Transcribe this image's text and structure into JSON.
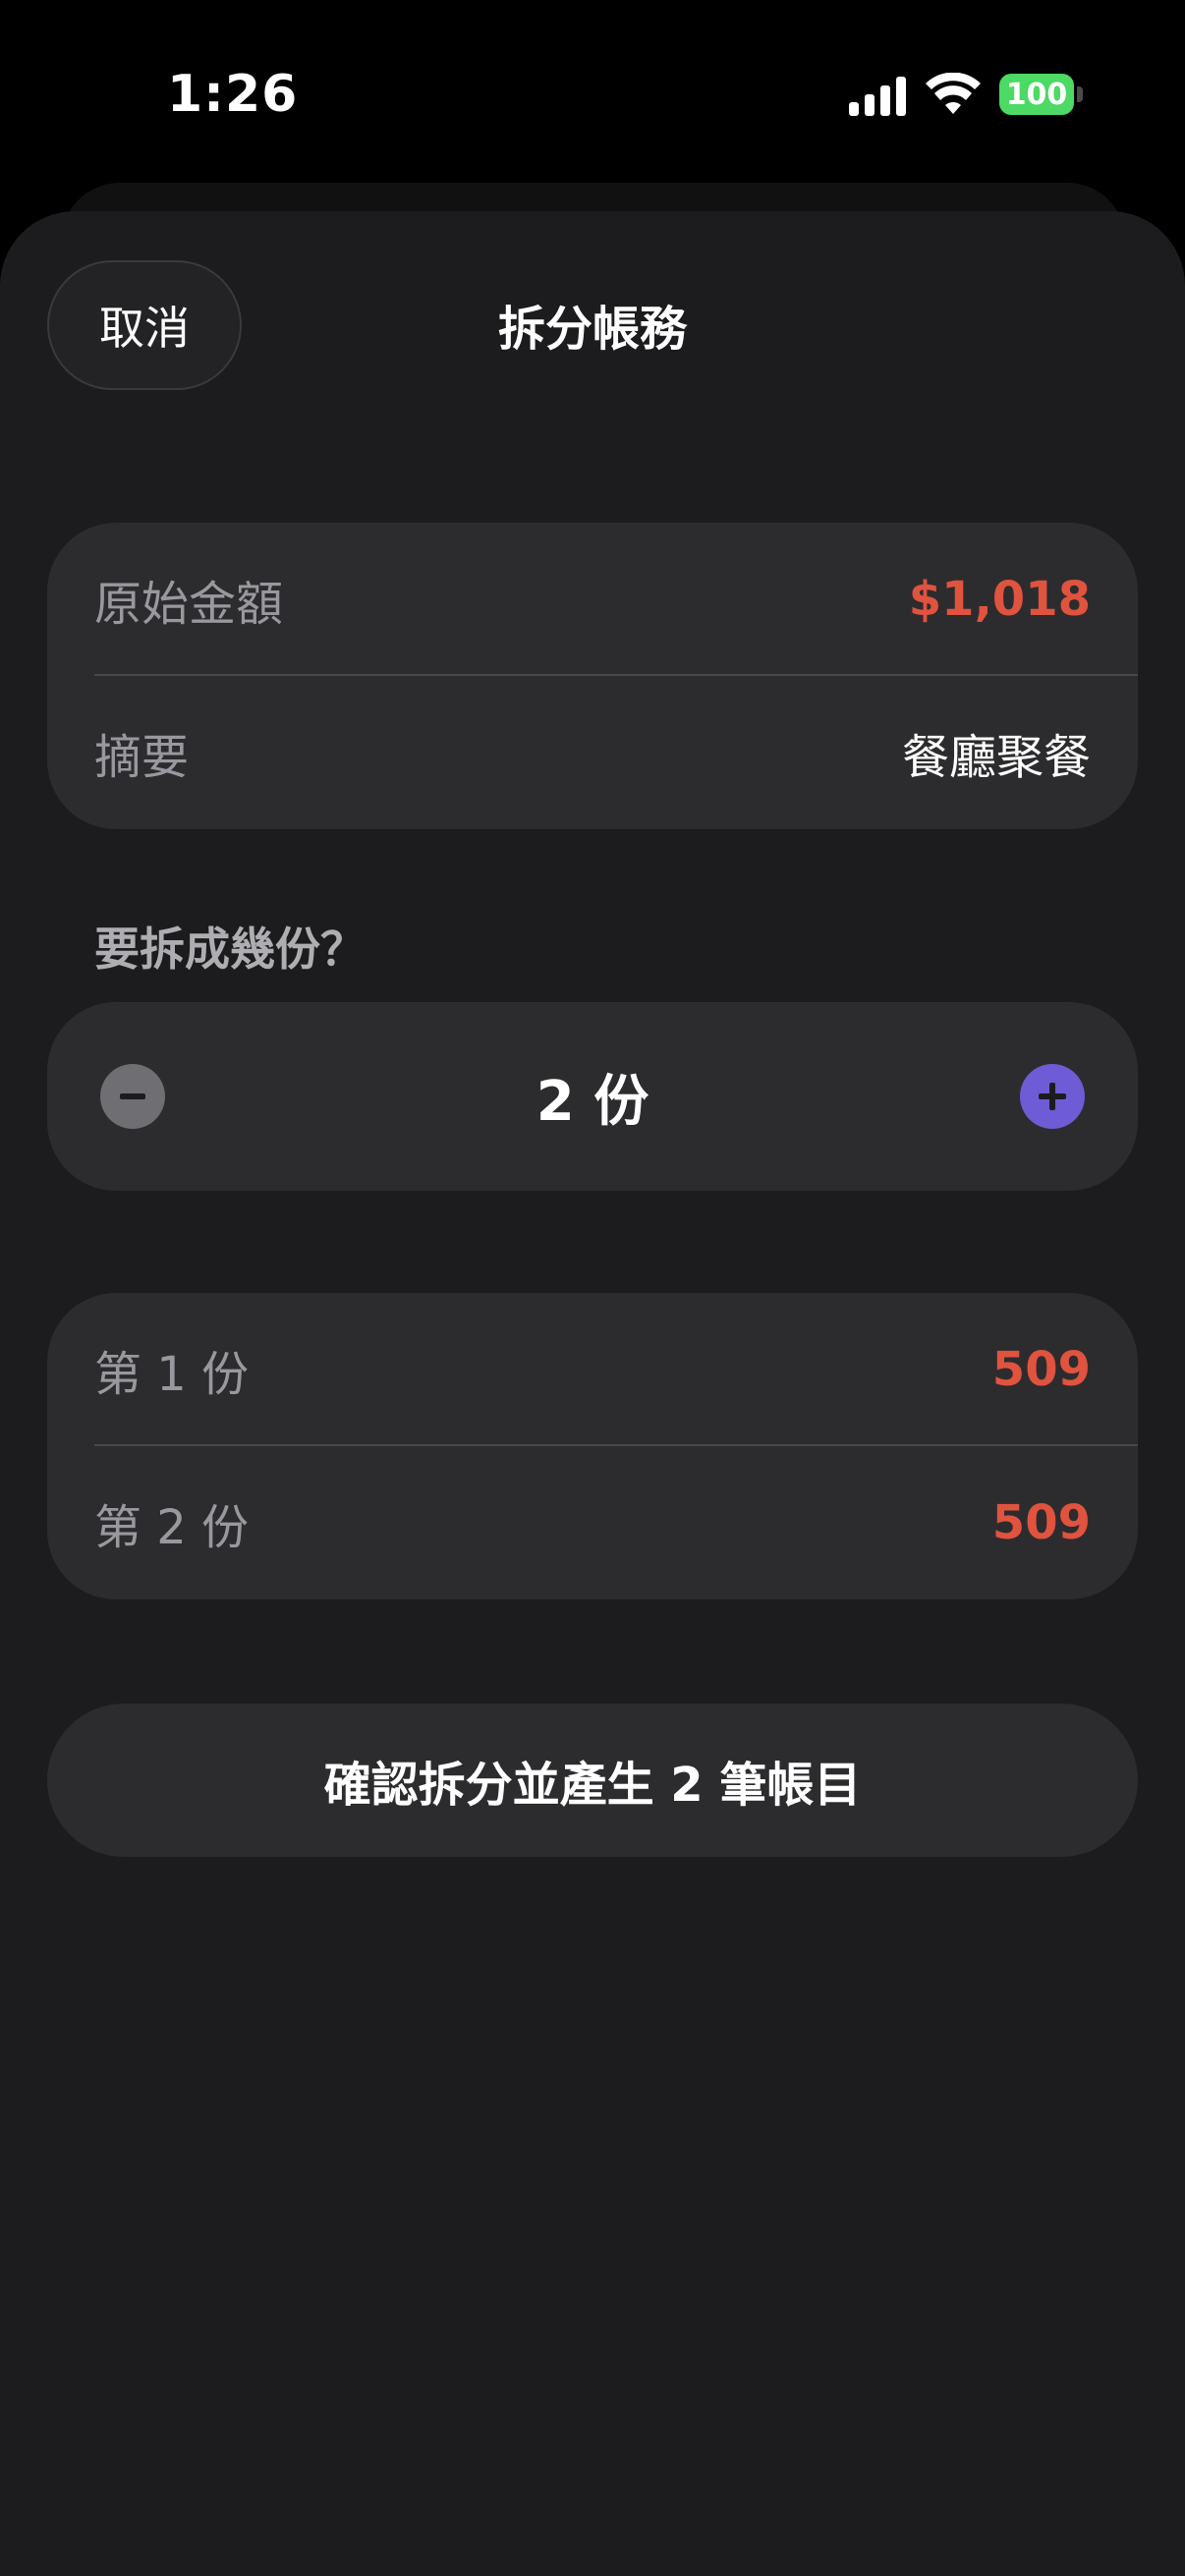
{
  "status_bar": {
    "time": "1:26",
    "battery": "100",
    "icons": [
      "signal-icon",
      "wifi-icon",
      "battery-icon"
    ],
    "battery_color": "#4cd964"
  },
  "header": {
    "cancel_label": "取消",
    "title": "拆分帳務"
  },
  "summary": {
    "amount_label": "原始金額",
    "amount_value": "$1,018",
    "memo_label": "摘要",
    "memo_value": "餐廳聚餐"
  },
  "split": {
    "question": "要拆成幾份？",
    "count_display": "2 份",
    "minus_icon": "minus-icon",
    "plus_icon": "plus-icon",
    "accent_color": "#6e5bd6"
  },
  "parts": [
    {
      "label": "第 1 份",
      "value": "509"
    },
    {
      "label": "第 2 份",
      "value": "509"
    }
  ],
  "confirm_label": "確認拆分並產生 2 筆帳目",
  "colors": {
    "amount_red": "#e0533f",
    "background": "#1c1c1e",
    "card": "#2c2c2e"
  }
}
